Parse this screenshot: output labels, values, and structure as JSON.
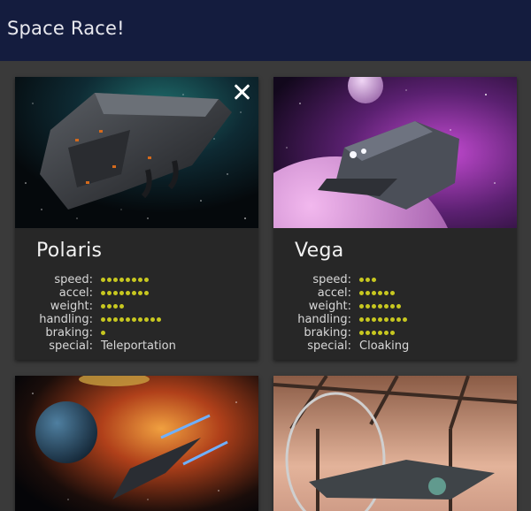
{
  "app": {
    "title": "Space Race!"
  },
  "close_icon": "close-icon",
  "colors": {
    "appbar": "#141c3e",
    "background": "#3a3a3a",
    "card": "#272727",
    "stat_dot": "#c8c820"
  },
  "ships": [
    {
      "name": "Polaris",
      "stats": [
        {
          "label": "speed:",
          "value": 8
        },
        {
          "label": "accel:",
          "value": 8
        },
        {
          "label": "weight:",
          "value": 4
        },
        {
          "label": "handling:",
          "value": 10
        },
        {
          "label": "braking:",
          "value": 1
        }
      ],
      "special_label": "special:",
      "special": "Teleportation"
    },
    {
      "name": "Vega",
      "stats": [
        {
          "label": "speed:",
          "value": 3
        },
        {
          "label": "accel:",
          "value": 6
        },
        {
          "label": "weight:",
          "value": 7
        },
        {
          "label": "handling:",
          "value": 8
        },
        {
          "label": "braking:",
          "value": 6
        }
      ],
      "special_label": "special:",
      "special": "Cloaking"
    }
  ]
}
